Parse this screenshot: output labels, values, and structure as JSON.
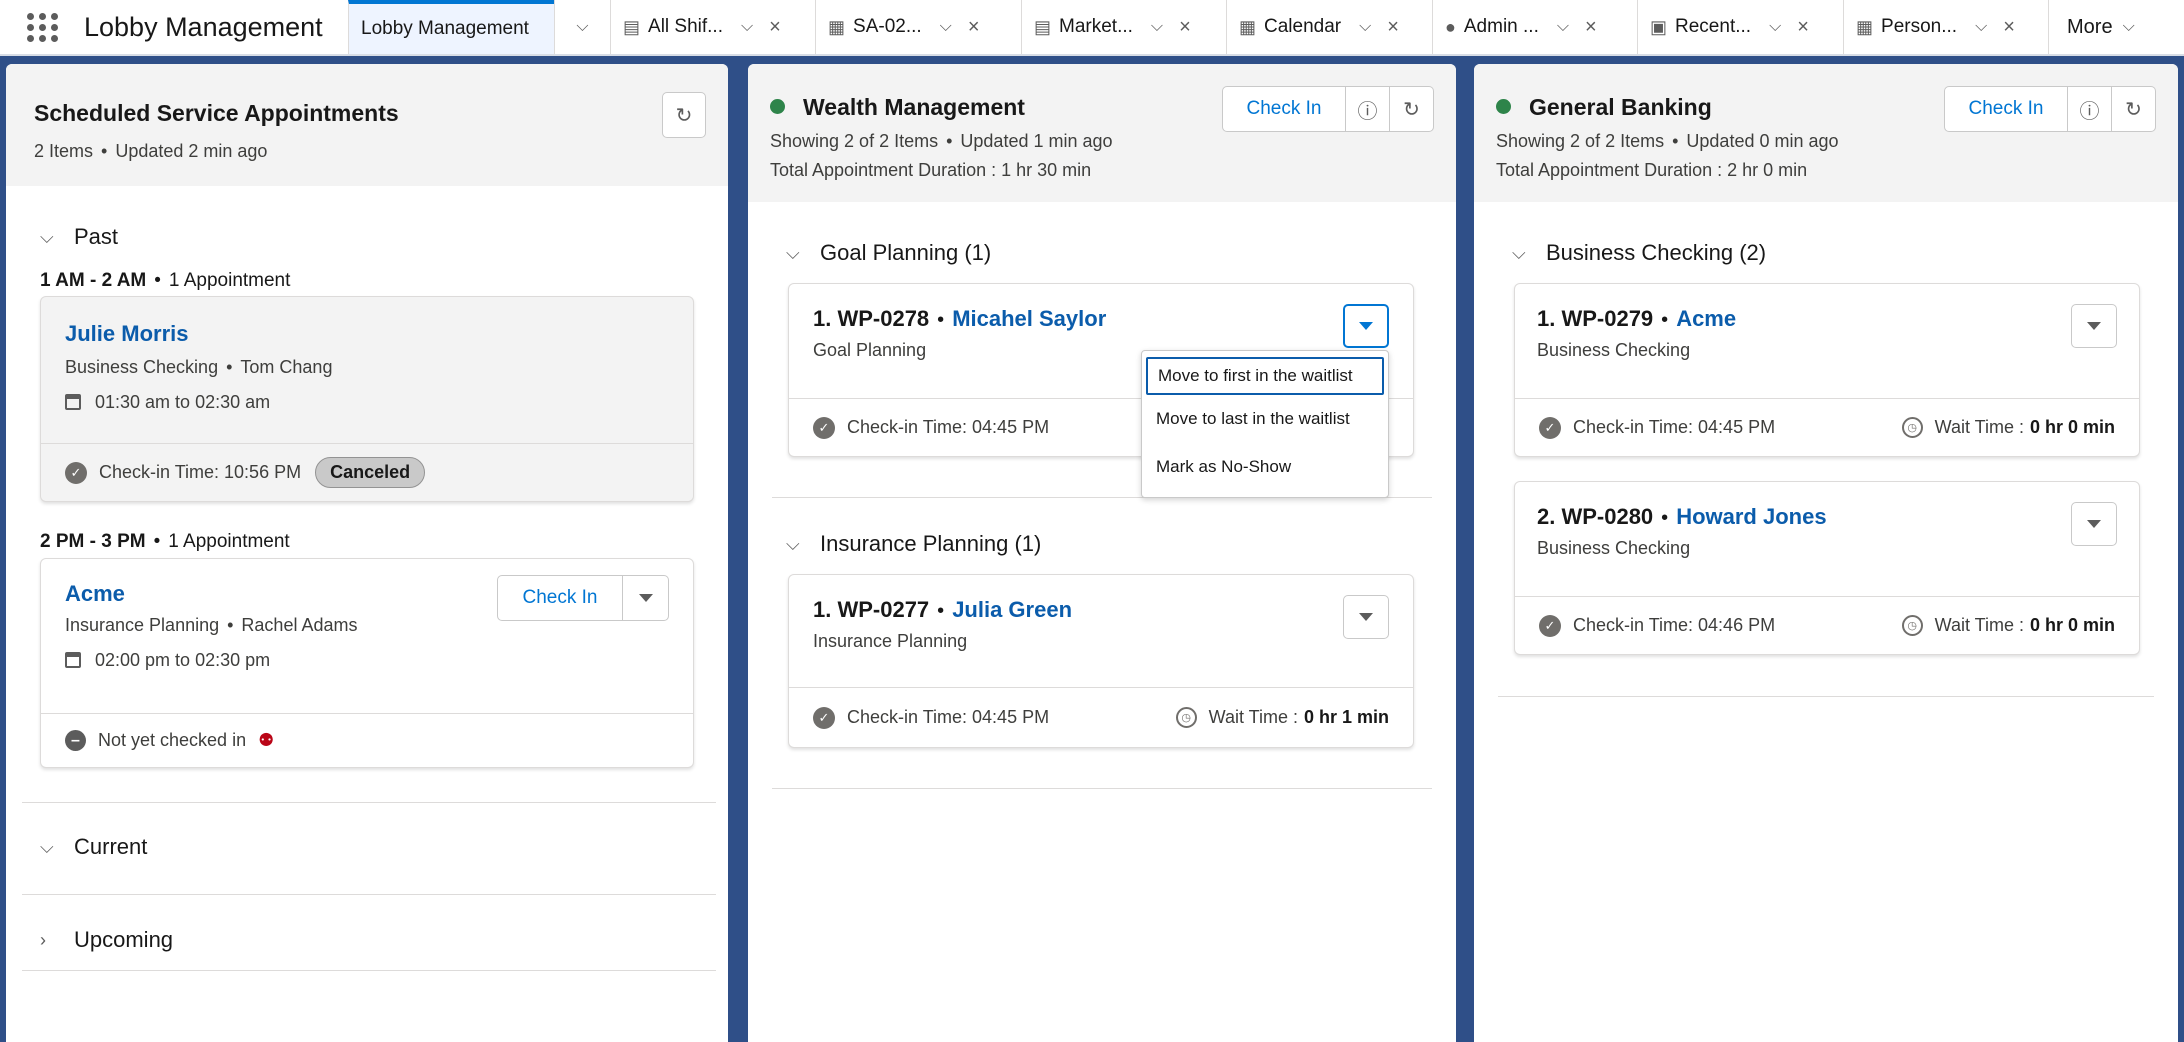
{
  "nav": {
    "app_name": "Lobby Management",
    "tabs": [
      {
        "label": "Lobby Management",
        "icon": ""
      },
      {
        "label": "All Shif...",
        "icon": "calendar-clock-icon"
      },
      {
        "label": "SA-02...",
        "icon": "service-appointment-icon"
      },
      {
        "label": "Market...",
        "icon": "calendar-clock-icon"
      },
      {
        "label": "Calendar",
        "icon": "calendar-icon"
      },
      {
        "label": "Admin ...",
        "icon": "user-icon"
      },
      {
        "label": "Recent...",
        "icon": "recent-icon"
      },
      {
        "label": "Person...",
        "icon": "calendar-icon"
      }
    ],
    "more_label": "More"
  },
  "scheduled": {
    "title": "Scheduled Service Appointments",
    "count": "2 Items",
    "updated": "Updated 2 min ago",
    "past_label": "Past",
    "current_label": "Current",
    "upcoming_label": "Upcoming",
    "slot1": {
      "time": "1 AM - 2 AM",
      "count": "1 Appointment"
    },
    "appt1": {
      "name": "Julie Morris",
      "type": "Business Checking",
      "agent": "Tom Chang",
      "time": "01:30 am to 02:30 am",
      "checkin": "Check-in Time: 10:56 PM",
      "status": "Canceled"
    },
    "slot2": {
      "time": "2 PM - 3 PM",
      "count": "1 Appointment"
    },
    "appt2": {
      "name": "Acme",
      "type": "Insurance Planning",
      "agent": "Rachel Adams",
      "time": "02:00 pm to 02:30 pm",
      "status_text": "Not yet checked in",
      "checkin_label": "Check In"
    }
  },
  "wealth": {
    "title": "Wealth Management",
    "showing": "Showing 2 of 2 Items",
    "updated": "Updated 1 min ago",
    "duration": "Total Appointment Duration : 1 hr 30 min",
    "checkin_label": "Check In",
    "group1": {
      "label": "Goal Planning (1)",
      "item": {
        "ticket": "1. WP-0278",
        "name": "Micahel Saylor",
        "type": "Goal Planning",
        "checkin": "Check-in Time: 04:45 PM"
      }
    },
    "group2": {
      "label": "Insurance Planning (1)",
      "item": {
        "ticket": "1. WP-0277",
        "name": "Julia Green",
        "type": "Insurance Planning",
        "checkin": "Check-in Time: 04:45 PM",
        "wait_label": "Wait Time :",
        "wait": "0 hr 1 min"
      }
    },
    "menu": [
      "Move to first in the waitlist",
      "Move to last in the waitlist",
      "Mark as No-Show"
    ]
  },
  "banking": {
    "title": "General Banking",
    "showing": "Showing 2 of 2 Items",
    "updated": "Updated 0 min ago",
    "duration": "Total Appointment Duration : 2 hr 0 min",
    "checkin_label": "Check In",
    "group1": {
      "label": "Business Checking (2)"
    },
    "item1": {
      "ticket": "1. WP-0279",
      "name": "Acme",
      "type": "Business Checking",
      "checkin": "Check-in Time: 04:45 PM",
      "wait_label": "Wait Time :",
      "wait": "0 hr 0 min"
    },
    "item2": {
      "ticket": "2. WP-0280",
      "name": "Howard Jones",
      "type": "Business Checking",
      "checkin": "Check-in Time: 04:46 PM",
      "wait_label": "Wait Time :",
      "wait": "0 hr 0 min"
    }
  },
  "colors": {
    "brand": "#0176d3",
    "link": "#0b5cab",
    "online": "#2e844a",
    "background": "#2f4f88"
  }
}
